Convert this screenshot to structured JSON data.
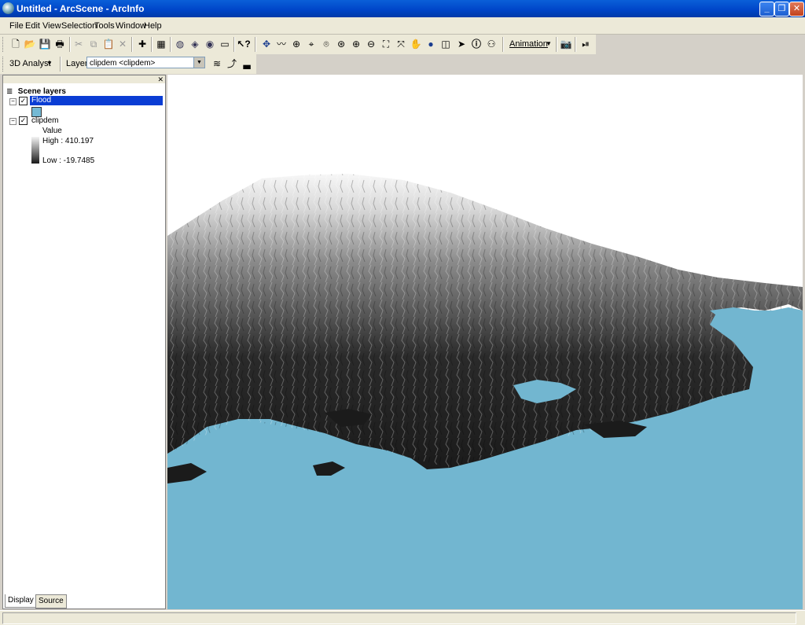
{
  "window": {
    "title": "Untitled - ArcScene - ArcInfo"
  },
  "menu": {
    "items": [
      "File",
      "Edit",
      "View",
      "Selection",
      "Tools",
      "Window",
      "Help"
    ]
  },
  "toolbar": {
    "animation_label": "Animation"
  },
  "analyst_toolbar": {
    "analyst_label": "3D Analyst",
    "layer_label": "Layer:",
    "layer_value": "clipdem <clipdem>"
  },
  "toc": {
    "root_label": "Scene layers",
    "layers": [
      {
        "name": "Flood",
        "checked": true,
        "selected": true,
        "swatch_color": "#74b9d4"
      },
      {
        "name": "clipdem",
        "checked": true,
        "selected": false
      }
    ],
    "legend": {
      "field": "Value",
      "high": "High : 410.197",
      "low": "Low : -19.7485"
    },
    "tabs": [
      "Display",
      "Source"
    ]
  },
  "scene": {
    "water_color": "#72b6d0",
    "terrain_dark": "#1e1e1e",
    "terrain_light": "#f4f4f4"
  }
}
